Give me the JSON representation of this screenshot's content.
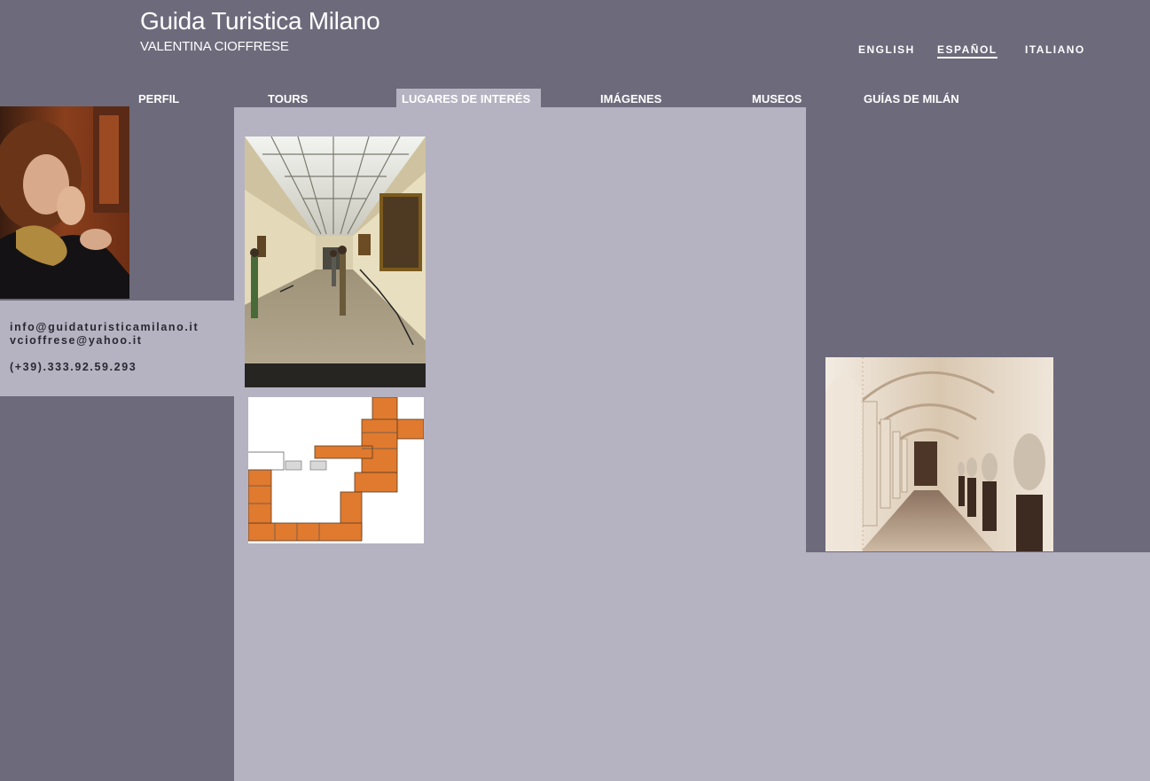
{
  "header": {
    "title": "Guida Turistica Milano",
    "subtitle": "VALENTINA CIOFFRESE"
  },
  "languages": [
    {
      "label": "ENGLISH",
      "active": false
    },
    {
      "label": "ESPAÑOL",
      "active": true
    },
    {
      "label": "ITALIANO",
      "active": false
    }
  ],
  "nav": [
    {
      "label": "PERFIL"
    },
    {
      "label": "TOURS"
    },
    {
      "label": "LUGARES DE INTERÉS",
      "active": true
    },
    {
      "label": "IMÁGENES"
    },
    {
      "label": "MUSEOS"
    },
    {
      "label": "GUÍAS DE MILÁN"
    }
  ],
  "contact": {
    "email1": "info@guidaturisticamilano.it",
    "email2": "vcioffrese@yahoo.it",
    "phone": "(+39).333.92.59.293"
  },
  "colors": {
    "background": "#6d6a7b",
    "panel": "#b5b3c1",
    "text": "#ffffff",
    "floorplan_rooms": "#e07a2e"
  },
  "icons": [
    "portrait-photo",
    "gallery-photo",
    "floor-plan",
    "cloister-photo"
  ]
}
